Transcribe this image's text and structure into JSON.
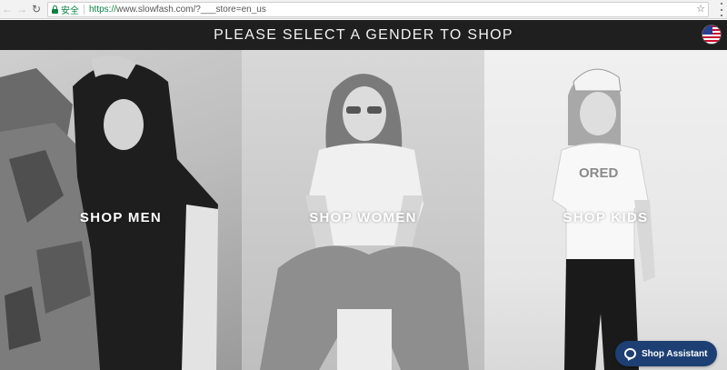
{
  "browser": {
    "back": "←",
    "forward": "→",
    "reload": "↻",
    "secure_label": "安全",
    "url_scheme": "https://",
    "url_rest": "www.slowfash.com/?___store=en_us",
    "star": "☆"
  },
  "header": {
    "title": "PLEASE SELECT A GENDER TO SHOP",
    "flag": "us-flag-icon"
  },
  "panels": {
    "men": {
      "label": "SHOP MEN"
    },
    "women": {
      "label": "SHOP WOMEN"
    },
    "kids": {
      "label": "SHOP KIDS"
    }
  },
  "kids_shirt_text": "ORED",
  "assistant": {
    "label": "Shop Assistant",
    "color": "#1d3f73"
  }
}
